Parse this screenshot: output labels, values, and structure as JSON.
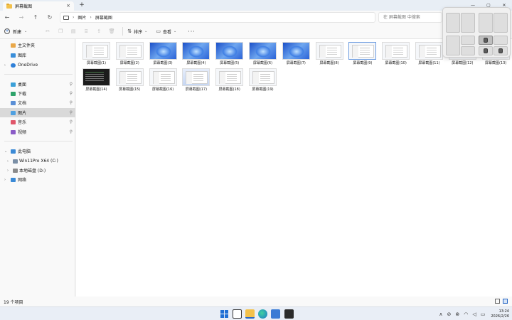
{
  "window": {
    "tab_title": "屏幕截图",
    "new_tab": "+",
    "controls": {
      "minimize": "—",
      "maximize": "▢",
      "close": "✕"
    }
  },
  "nav": {
    "back": "←",
    "forward": "→",
    "up": "↑",
    "refresh": "↻",
    "breadcrumb": [
      "图片",
      "屏幕截图"
    ],
    "search_placeholder": "在 屏幕截图 中搜索"
  },
  "toolbar": {
    "new_label": "新建",
    "sort_label": "排序",
    "view_label": "查看",
    "more": "···"
  },
  "sidebar": {
    "home": "主文件夹",
    "gallery": "图库",
    "onedrive": "OneDrive",
    "quick": [
      {
        "label": "桌面",
        "color": "#3ba0d8"
      },
      {
        "label": "下载",
        "color": "#2ea36b"
      },
      {
        "label": "文档",
        "color": "#5a8fd6"
      },
      {
        "label": "图片",
        "color": "#4fa0e0"
      },
      {
        "label": "音乐",
        "color": "#e0566a"
      },
      {
        "label": "视频",
        "color": "#8b5cc7"
      }
    ],
    "this_pc": "此电脑",
    "drives": [
      "Win11Pro X64 (C:)",
      "本地磁盘 (D:)"
    ],
    "network": "网络"
  },
  "files": [
    {
      "name": "屏幕截图(1)",
      "kind": "window"
    },
    {
      "name": "屏幕截图(2)",
      "kind": "window"
    },
    {
      "name": "屏幕截图(3)",
      "kind": "win11"
    },
    {
      "name": "屏幕截图(4)",
      "kind": "win11"
    },
    {
      "name": "屏幕截图(5)",
      "kind": "win11"
    },
    {
      "name": "屏幕截图(6)",
      "kind": "win11"
    },
    {
      "name": "屏幕截图(7)",
      "kind": "win11"
    },
    {
      "name": "屏幕截图(8)",
      "kind": "window"
    },
    {
      "name": "屏幕截图(9)",
      "kind": "window"
    },
    {
      "name": "屏幕截图(10)",
      "kind": "window"
    },
    {
      "name": "屏幕截图(11)",
      "kind": "window"
    },
    {
      "name": "屏幕截图(12)",
      "kind": "window"
    },
    {
      "name": "屏幕截图(13)",
      "kind": "window"
    },
    {
      "name": "屏幕截图(14)",
      "kind": "dark"
    },
    {
      "name": "屏幕截图(15)",
      "kind": "window"
    },
    {
      "name": "屏幕截图(16)",
      "kind": "window"
    },
    {
      "name": "屏幕截图(17)",
      "kind": "light"
    },
    {
      "name": "屏幕截图(18)",
      "kind": "window"
    },
    {
      "name": "屏幕截图(19)",
      "kind": "window"
    }
  ],
  "status": {
    "count": "19 个项目"
  },
  "taskbar": {
    "time": "13:24",
    "date": "2026/2/26",
    "tray_chevron": "∧"
  }
}
